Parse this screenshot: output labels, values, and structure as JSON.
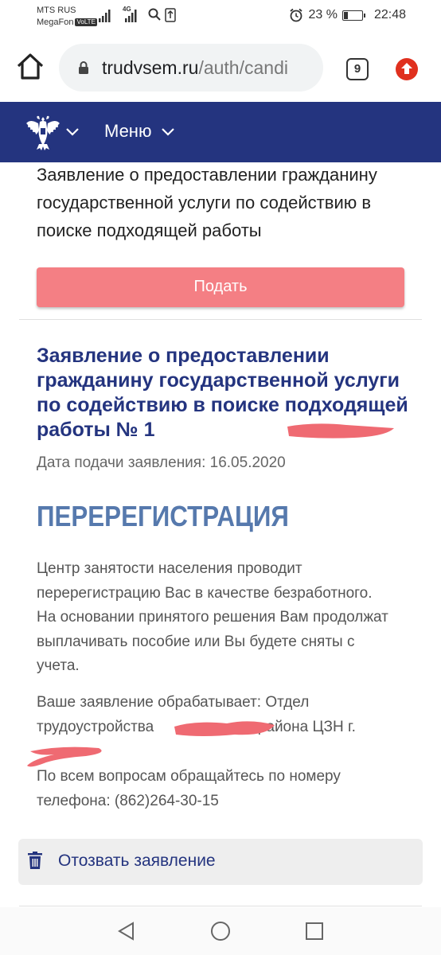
{
  "status_bar": {
    "carrier_1": "MTS RUS",
    "carrier_2": "MegaFon",
    "volte": "VoLTE",
    "network": "4G",
    "battery_percent": "23 %",
    "battery_level": 0.23,
    "time": "22:48"
  },
  "browser": {
    "url_host": "trudvsem.ru",
    "url_path": "/auth/candi",
    "tab_count": "9"
  },
  "site_header": {
    "menu_label": "Меню"
  },
  "previous_application": {
    "title": "Заявление о предоставлении гражданину государственной услуги по содействию в поиске подходящей работы",
    "submit_label": "Подать"
  },
  "application": {
    "title": "Заявление о предоставлении гражданину государственной услуги по содействию в поиске подходящей работы № 1",
    "date_label": "Дата подачи заявления: 16.05.2020",
    "section_heading": "ПЕРЕРЕГИСТРАЦИЯ",
    "description": "Центр занятости населения проводит перерегистрацию Вас в качестве безработного. На основании принятого решения Вам продолжат выплачивать пособие или Вы будете сняты с учета.",
    "processor_prefix": "Ваше заявление обрабатывает: Отдел трудоустройства ",
    "processor_suffix": " района ЦЗН г.",
    "contact": "По всем вопросам обращайтесь по номеру телефона: (862)264-30-15",
    "withdraw_label": "Отозвать заявление"
  },
  "colors": {
    "header_blue": "#24347f",
    "submit_pink": "#f47f84",
    "heading_blue": "#5679ad",
    "redaction": "#ef6a72"
  }
}
